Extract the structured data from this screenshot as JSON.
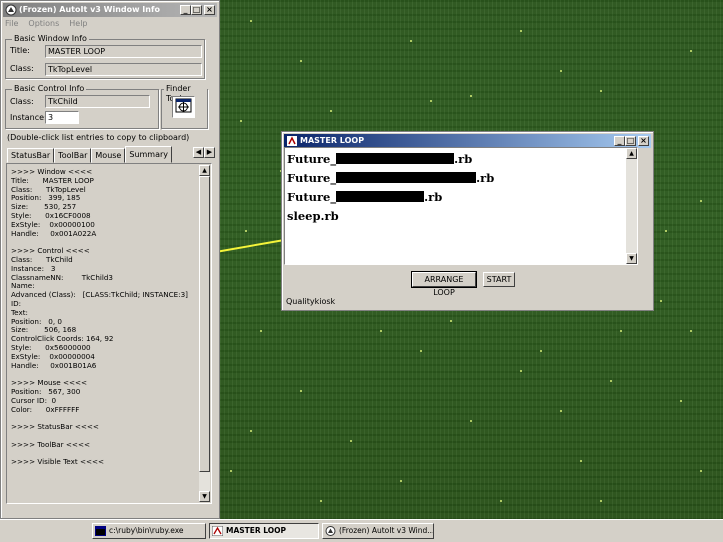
{
  "autoit": {
    "title": "(Frozen) AutoIt v3 Window Info",
    "menu": [
      "File",
      "Options",
      "Help"
    ],
    "basic_window": {
      "group_label": "Basic Window Info",
      "title_label": "Title:",
      "title_value": "MASTER LOOP",
      "class_label": "Class:",
      "class_value": "TkTopLevel"
    },
    "basic_control": {
      "group_label": "Basic Control Info",
      "class_label": "Class:",
      "class_value": "TkChild",
      "instance_label": "Instance:",
      "instance_value": "3"
    },
    "finder_tool": {
      "group_label": "Finder Tool"
    },
    "hint": "(Double-click list entries to copy to clipboard)",
    "tabs": [
      "StatusBar",
      "ToolBar",
      "Mouse",
      "Summary"
    ],
    "summary_lines": [
      ">>>> Window <<<<",
      "Title:      MASTER LOOP",
      "Class:      TkTopLevel",
      "Position:   399, 185",
      "Size:       530, 257",
      "Style:      0x16CF0008",
      "ExStyle:    0x00000100",
      "Handle:     0x001A022A",
      "",
      ">>>> Control <<<<",
      "Class:      TkChild",
      "Instance:   3",
      "ClassnameNN:        TkChild3",
      "Name:",
      "Advanced (Class):   [CLASS:TkChild; INSTANCE:3]",
      "ID:",
      "Text:",
      "Position:   0, 0",
      "Size:       506, 168",
      "ControlClick Coords: 164, 92",
      "Style:      0x56000000",
      "ExStyle:    0x00000004",
      "Handle:     0x001B01A6",
      "",
      ">>>> Mouse <<<<",
      "Position:   567, 300",
      "Cursor ID:  0",
      "Color:      0xFFFFFF",
      "",
      ">>>> StatusBar <<<<",
      "",
      ">>>> ToolBar <<<<",
      "",
      ">>>> Visible Text <<<<"
    ]
  },
  "master_loop": {
    "title": "MASTER LOOP",
    "files": [
      {
        "prefix": "Future_",
        "suffix": ".rb"
      },
      {
        "prefix": "Future_",
        "suffix": ".rb"
      },
      {
        "prefix": "Future_",
        "suffix": ".rb"
      },
      {
        "prefix": "sleep.rb",
        "suffix": ""
      }
    ],
    "arrange_button": "ARRANGE LOOP",
    "start_button": "START",
    "status": "Qualitykiosk"
  },
  "taskbar": {
    "items": [
      {
        "label": "c:\\ruby\\bin\\ruby.exe",
        "icon": "console-icon"
      },
      {
        "label": "MASTER LOOP",
        "icon": "tk-icon"
      },
      {
        "label": "(Frozen) AutoIt v3 Wind...",
        "icon": "autoit-icon"
      }
    ]
  },
  "colors": {
    "active_title": "#0a246a",
    "arrow": "#f5f53a",
    "desktop": "#2f5a1f"
  }
}
